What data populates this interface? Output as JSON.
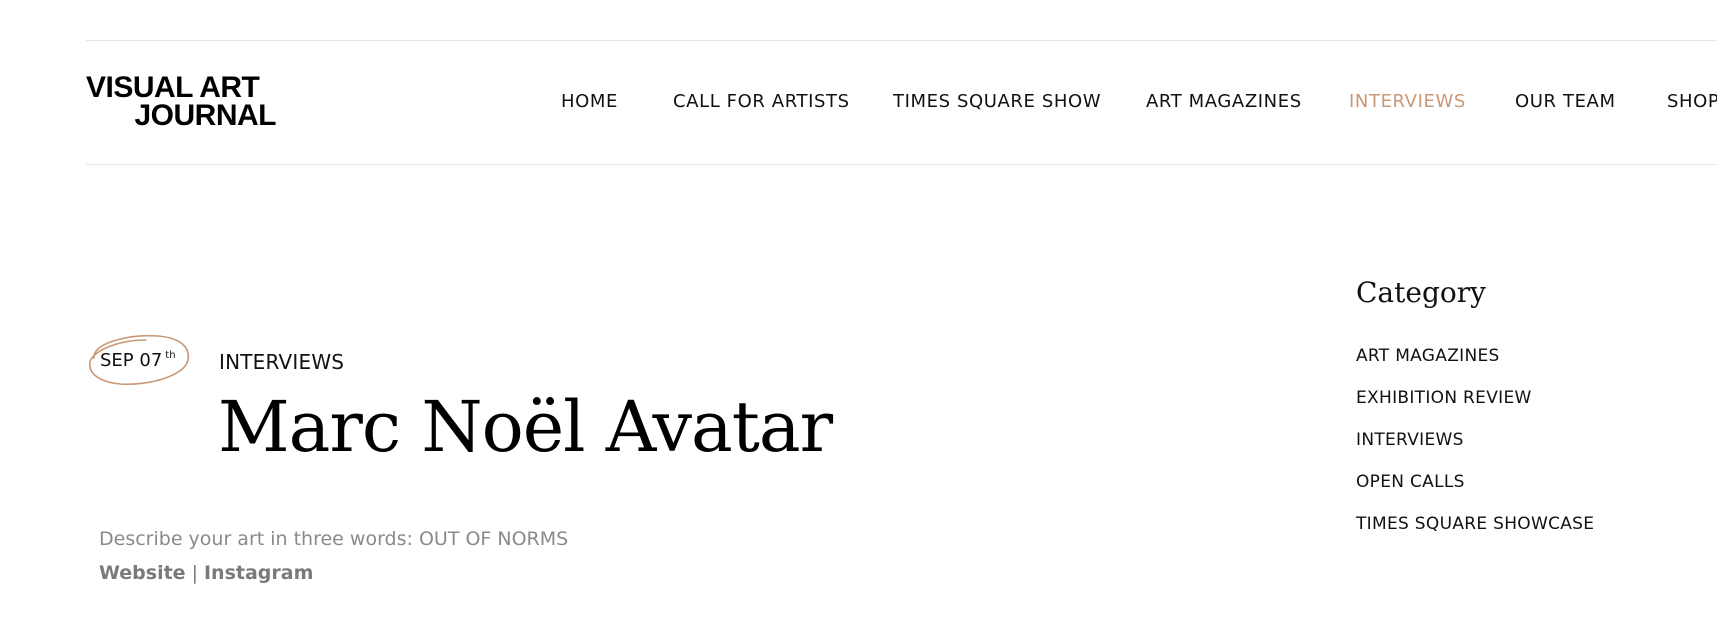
{
  "logo": {
    "line1": "VISUAL ART",
    "line2": "JOURNAL"
  },
  "nav": {
    "items": [
      {
        "label": "HOME"
      },
      {
        "label": "CALL FOR ARTISTS"
      },
      {
        "label": "TIMES SQUARE SHOW"
      },
      {
        "label": "ART MAGAZINES"
      },
      {
        "label": "INTERVIEWS",
        "active": true
      },
      {
        "label": "OUR TEAM"
      },
      {
        "label": "SHOP"
      }
    ]
  },
  "post": {
    "date": {
      "month_day": "SEP 07",
      "suffix": "th"
    },
    "category": "INTERVIEWS",
    "title": "Marc Noël Avatar",
    "excerpt": "Describe your art in three words: OUT OF NORMS",
    "links": {
      "website": "Website",
      "separator": "|",
      "instagram": "Instagram"
    }
  },
  "sidebar": {
    "title": "Category",
    "categories": [
      {
        "label": "ART MAGAZINES"
      },
      {
        "label": "EXHIBITION REVIEW"
      },
      {
        "label": "INTERVIEWS"
      },
      {
        "label": "OPEN CALLS"
      },
      {
        "label": "TIMES SQUARE SHOWCASE"
      }
    ]
  },
  "colors": {
    "accent": "#c99876",
    "text": "#111111",
    "muted": "#8a8a8a",
    "rule": "#e6e6e6"
  }
}
